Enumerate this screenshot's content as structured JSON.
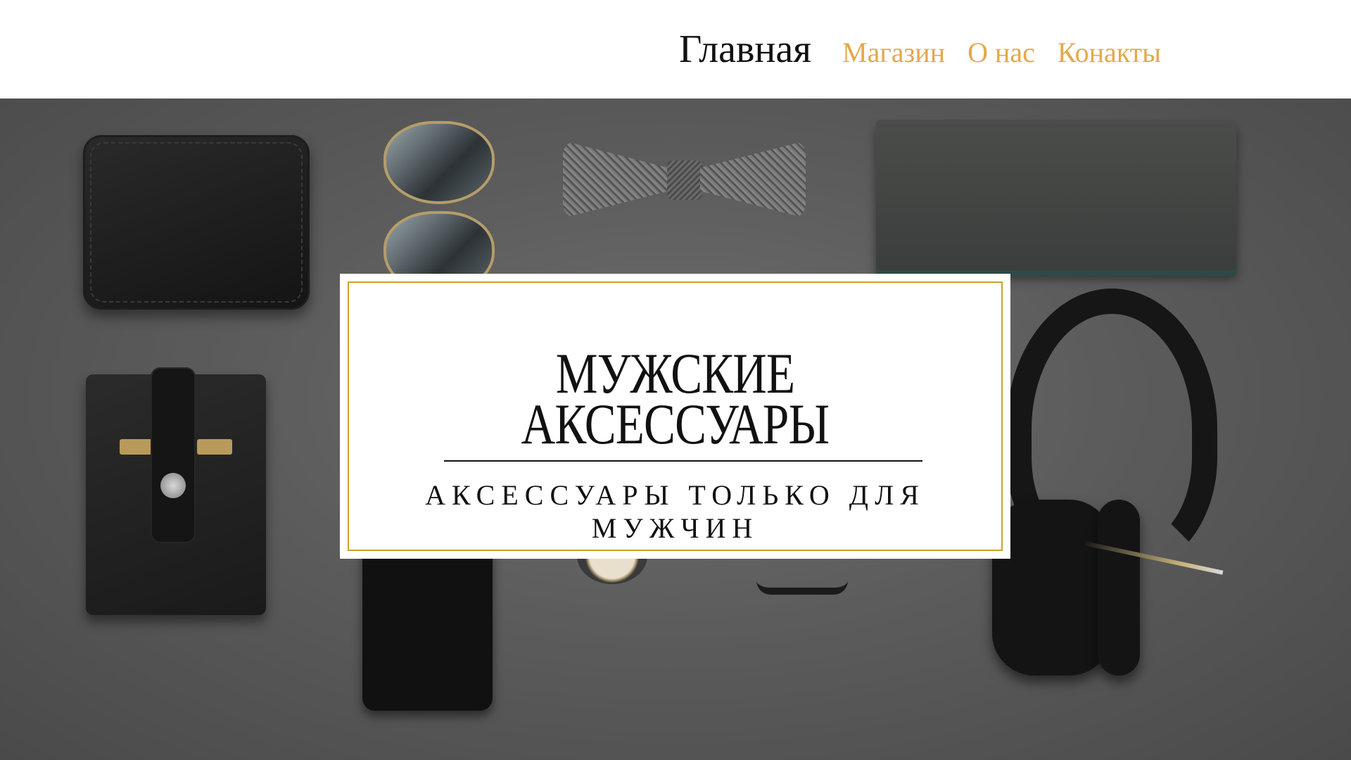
{
  "nav": {
    "items": [
      {
        "label": "Главная",
        "active": true
      },
      {
        "label": "Магазин",
        "active": false
      },
      {
        "label": "О нас",
        "active": false
      },
      {
        "label": "Конакты",
        "active": false
      }
    ],
    "active_color": "#111111",
    "link_color": "#E3A94A"
  },
  "hero": {
    "title_line1": "МУЖСКИЕ",
    "title_line2": "АКСЕССУАРЫ",
    "subtitle": "АКСЕССУАРЫ ТОЛЬКО ДЛЯ МУЖЧИН",
    "border_color": "#C9A227",
    "background_image": "men-accessories-flatlay"
  }
}
